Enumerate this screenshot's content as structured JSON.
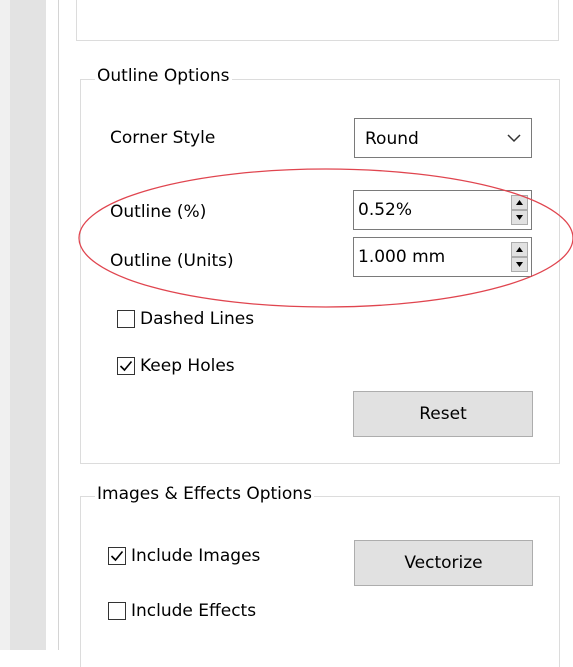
{
  "outline_options": {
    "legend": "Outline Options",
    "corner_style_label": "Corner Style",
    "corner_style_value": "Round",
    "outline_percent_label": "Outline (%)",
    "outline_percent_value": "0.52%",
    "outline_units_label": "Outline (Units)",
    "outline_units_value": "1.000 mm",
    "dashed_lines_label": "Dashed Lines",
    "dashed_lines_checked": false,
    "keep_holes_label": "Keep Holes",
    "keep_holes_checked": true,
    "reset_label": "Reset"
  },
  "images_effects_options": {
    "legend": "Images & Effects Options",
    "include_images_label": "Include Images",
    "include_images_checked": true,
    "include_effects_label": "Include Effects",
    "include_effects_checked": false,
    "vectorize_label": "Vectorize"
  },
  "annotation": {
    "ellipse_color": "#e0454f"
  },
  "icons": [
    "chevron-down-icon",
    "spin-up-icon",
    "spin-down-icon",
    "checkmark-icon"
  ]
}
